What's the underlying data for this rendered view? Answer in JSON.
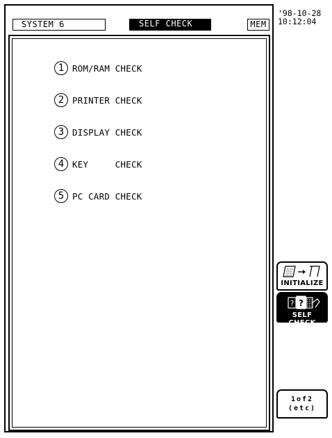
{
  "header": {
    "system": "SYSTEM 6",
    "title": "SELF CHECK",
    "mem": "MEM"
  },
  "clock": {
    "date": "'98-10-28",
    "time": "10:12:04"
  },
  "menu": [
    {
      "number": "1",
      "label": "ROM/RAM CHECK"
    },
    {
      "number": "2",
      "label": "PRINTER CHECK"
    },
    {
      "number": "3",
      "label": "DISPLAY CHECK"
    },
    {
      "number": "4",
      "label": "KEY     CHECK"
    },
    {
      "number": "5",
      "label": "PC CARD CHECK"
    }
  ],
  "softkeys": {
    "initialize": {
      "label": "INITIALIZE",
      "icon": "initialize-icon"
    },
    "self_check": {
      "label": "SELF CHECK",
      "icon": "self-check-icon",
      "selected": true
    },
    "page": {
      "line1": "1of2",
      "line2": "(etc)"
    }
  }
}
